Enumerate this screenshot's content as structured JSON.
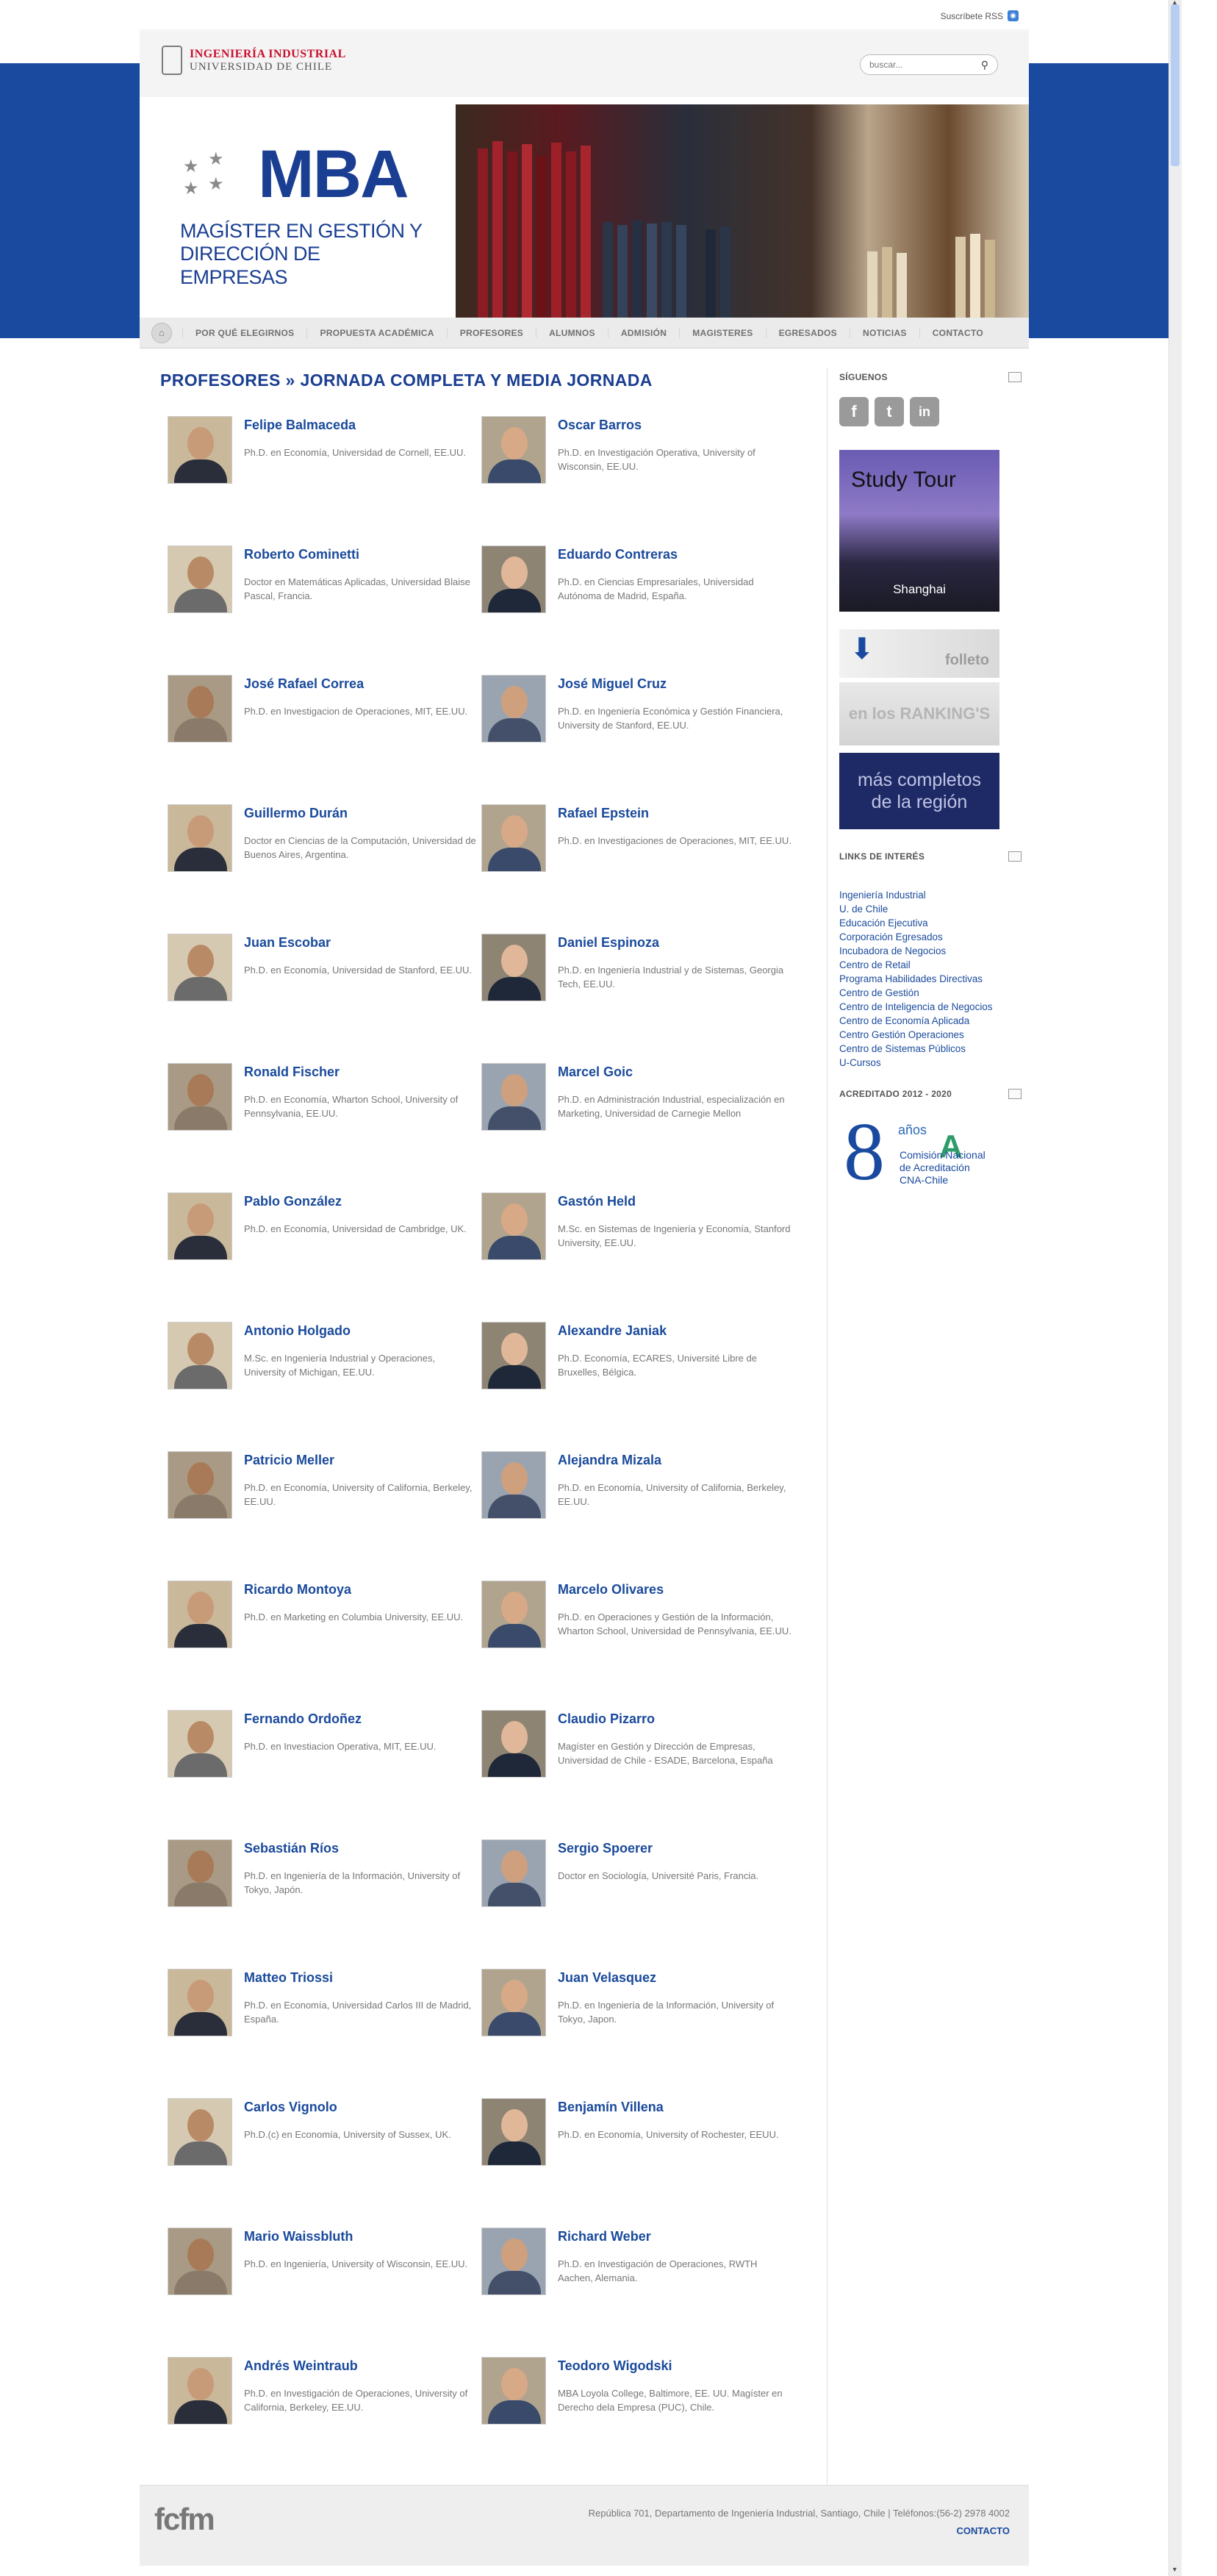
{
  "topbar": {
    "rss_label": "Suscríbete RSS"
  },
  "header": {
    "logo_line1": "INGENIERÍA INDUSTRIAL",
    "logo_line2": "UNIVERSIDAD DE CHILE",
    "search_placeholder": "buscar..."
  },
  "banner": {
    "mba": "MBA",
    "subtitle_line1": "MAGÍSTER EN GESTIÓN Y",
    "subtitle_line2": "DIRECCIÓN DE EMPRESAS"
  },
  "nav": {
    "items": [
      "POR QUÉ ELEGIRNOS",
      "PROPUESTA ACADÉMICA",
      "PROFESORES",
      "ALUMNOS",
      "ADMISIÓN",
      "MAGISTERES",
      "EGRESADOS",
      "NOTICIAS",
      "CONTACTO"
    ]
  },
  "main": {
    "title": "PROFESORES » JORNADA COMPLETA Y MEDIA JORNADA"
  },
  "professors": [
    {
      "name": "Felipe Balmaceda",
      "desc": "Ph.D. en Economía, Universidad de Cornell, EE.UU."
    },
    {
      "name": "Oscar Barros",
      "desc": "Ph.D. en Investigación Operativa, University of Wisconsin, EE.UU."
    },
    {
      "name": "Roberto Cominetti",
      "desc": "Doctor en Matemáticas Aplicadas, Universidad Blaise Pascal, Francia."
    },
    {
      "name": "Eduardo Contreras",
      "desc": "Ph.D. en Ciencias Empresariales, Universidad Autónoma de Madrid, España."
    },
    {
      "name": "José Rafael Correa",
      "desc": "Ph.D. en Investigacion de Operaciones, MIT, EE.UU."
    },
    {
      "name": "José Miguel Cruz",
      "desc": "Ph.D. en Ingeniería Económica y Gestión Financiera, University de Stanford, EE.UU."
    },
    {
      "name": "Guillermo Durán",
      "desc": "Doctor en Ciencias de la Computación, Universidad de Buenos Aires, Argentina."
    },
    {
      "name": "Rafael Epstein",
      "desc": "Ph.D. en Investigaciones de Operaciones, MIT, EE.UU."
    },
    {
      "name": "Juan Escobar",
      "desc": "Ph.D. en Economía, Universidad de Stanford, EE.UU."
    },
    {
      "name": "Daniel Espinoza",
      "desc": "Ph.D. en Ingeniería Industrial y de Sistemas, Georgia Tech, EE.UU."
    },
    {
      "name": "Ronald Fischer",
      "desc": "Ph.D. en Economía, Wharton School, University of Pennsylvania, EE.UU."
    },
    {
      "name": "Marcel Goic",
      "desc": "Ph.D. en Administración Industrial, especialización en Marketing, Universidad de Carnegie Mellon"
    },
    {
      "name": "Pablo González",
      "desc": "Ph.D. en Economía, Universidad de Cambridge, UK."
    },
    {
      "name": "Gastón Held",
      "desc": "M.Sc. en Sistemas de Ingeniería y Economía, Stanford University, EE.UU."
    },
    {
      "name": "Antonio Holgado",
      "desc": "M.Sc. en Ingeniería Industrial y Operaciones, University of Michigan, EE.UU."
    },
    {
      "name": "Alexandre Janiak",
      "desc": "Ph.D. Economía, ECARES, Université Libre de Bruxelles, Bélgica."
    },
    {
      "name": "Patricio Meller",
      "desc": "Ph.D. en Economía, University of California, Berkeley, EE.UU."
    },
    {
      "name": "Alejandra Mizala",
      "desc": "Ph.D. en Economía, University of California, Berkeley, EE.UU."
    },
    {
      "name": "Ricardo Montoya",
      "desc": "Ph.D. en Marketing en Columbia University, EE.UU."
    },
    {
      "name": "Marcelo Olivares",
      "desc": "Ph.D. en Operaciones y Gestión de la Información, Wharton School, Universidad de Pennsylvania, EE.UU."
    },
    {
      "name": "Fernando Ordoñez",
      "desc": "Ph.D. en Investiacion Operativa, MIT, EE.UU."
    },
    {
      "name": "Claudio Pizarro",
      "desc": "Magíster en Gestión y Dirección de Empresas, Universidad de Chile - ESADE, Barcelona, España"
    },
    {
      "name": "Sebastián Ríos",
      "desc": "Ph.D. en Ingeniería de la Información, University of Tokyo, Japón."
    },
    {
      "name": "Sergio Spoerer",
      "desc": "Doctor en Sociología, Université Paris, Francia."
    },
    {
      "name": "Matteo Triossi",
      "desc": "Ph.D. en Economía, Universidad Carlos III de Madrid, España."
    },
    {
      "name": "Juan Velasquez",
      "desc": "Ph.D. en Ingeniería de la Información, University of Tokyo, Japon."
    },
    {
      "name": "Carlos Vignolo",
      "desc": "Ph.D.(c) en Economía, University of Sussex, UK."
    },
    {
      "name": "Benjamín Villena",
      "desc": "Ph.D. en Economía, University of Rochester, EEUU."
    },
    {
      "name": "Mario Waissbluth",
      "desc": "Ph.D. en Ingeniería, University of Wisconsin, EE.UU."
    },
    {
      "name": "Richard Weber",
      "desc": "Ph.D. en Investigación de Operaciones, RWTH Aachen, Alemania."
    },
    {
      "name": "Andrés Weintraub",
      "desc": "Ph.D. en Investigación de Operaciones, University of California, Berkeley, EE.UU."
    },
    {
      "name": "Teodoro Wigodski",
      "desc": "MBA Loyola College, Baltimore, EE. UU. Magíster en Derecho dela Empresa (PUC), Chile."
    }
  ],
  "sidebar": {
    "follow_title": "SÍGUENOS",
    "social": [
      "f",
      "t",
      "in"
    ],
    "study_tour": "Study Tour",
    "study_city": "Shanghai",
    "folleto": "folleto",
    "ranking": "en los RANKING'S",
    "region_line1": "más completos",
    "region_line2": "de la región",
    "links_title": "LINKS DE INTERÉS",
    "links": [
      "Ingeniería Industrial",
      "U. de Chile",
      "Educación Ejecutiva",
      "Corporación Egresados",
      "Incubadora de Negocios",
      "Centro de Retail",
      "Programa Habilidades Directivas",
      "Centro de Gestión",
      "Centro de Inteligencia de Negocios",
      "Centro de Economía Aplicada",
      "Centro Gestión Operaciones",
      "Centro de Sistemas Públicos",
      "U-Cursos"
    ],
    "acred_title": "ACREDITADO 2012 - 2020",
    "acred_number": "8",
    "acred_years": "años",
    "acred_line1": "Comisión Nacional",
    "acred_line2": "de Acreditación",
    "acred_line3": "CNA-Chile"
  },
  "footer": {
    "logo": "fcfm",
    "address": "República 701, Departamento de Ingeniería Industrial, Santiago, Chile | Teléfonos:(56-2) 2978 4002",
    "contact": "CONTACTO"
  }
}
